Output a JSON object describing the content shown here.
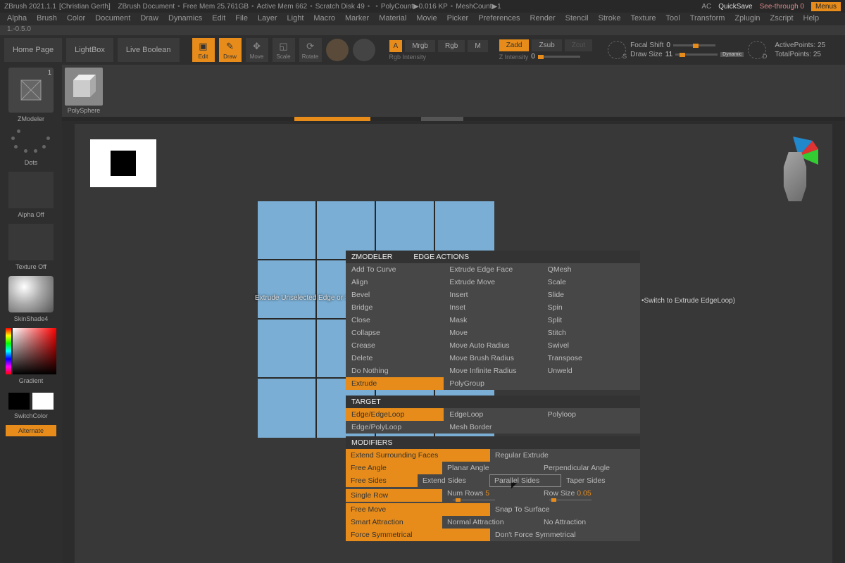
{
  "title": {
    "app": "ZBrush 2021.1.1",
    "user": "[Christian Gerth]",
    "doc": "ZBrush Document",
    "mem": "Free Mem 25.761GB",
    "active": "Active Mem 662",
    "scratch": "Scratch Disk 49",
    "poly": "PolyCount▶0.016 KP",
    "mesh": "MeshCount▶1",
    "ac": "AC",
    "quicksave": "QuickSave",
    "see": "See-through  0",
    "menus": "Menus"
  },
  "menu": [
    "Alpha",
    "Brush",
    "Color",
    "Document",
    "Draw",
    "Dynamics",
    "Edit",
    "File",
    "Layer",
    "Light",
    "Macro",
    "Marker",
    "Material",
    "Movie",
    "Picker",
    "Preferences",
    "Render",
    "Stencil",
    "Stroke",
    "Texture",
    "Tool",
    "Transform",
    "Zplugin",
    "Zscript",
    "Help"
  ],
  "subline": "1.-0.5.0",
  "tabs": {
    "home": "Home Page",
    "lightbox": "LightBox",
    "livebool": "Live Boolean"
  },
  "icons": {
    "edit": "Edit",
    "draw": "Draw",
    "move": "Move",
    "scale": "Scale",
    "rotate": "Rotate"
  },
  "rgb": {
    "a": "A",
    "mrgb": "Mrgb",
    "rgb": "Rgb",
    "m": "M",
    "intlabel": "Rgb Intensity"
  },
  "zmode": {
    "zadd": "Zadd",
    "zsub": "Zsub",
    "zcut": "Zcut",
    "zlabel": "Z Intensity",
    "zval": "0"
  },
  "focal": {
    "label": "Focal Shift",
    "val": "0"
  },
  "drawsize": {
    "label": "Draw Size",
    "val": "11",
    "dyn": "Dynamic"
  },
  "points": {
    "active": "ActivePoints: 25",
    "total": "TotalPoints: 25"
  },
  "left": {
    "brush": "ZModeler",
    "dots": "Dots",
    "alpha": "Alpha Off",
    "tex": "Texture Off",
    "mat": "SkinShade4",
    "gradient": "Gradient",
    "switch": "SwitchColor",
    "alt": "Alternate"
  },
  "polysphere": "PolySphere",
  "mesh_annot": "Extrude Unselected Edge or S",
  "hint_switch": "•Switch to Extrude EdgeLoop)",
  "zmodeler": {
    "header": {
      "z": "ZMODELER",
      "ea": "EDGE ACTIONS"
    },
    "col1": [
      "Add To Curve",
      "Align",
      "Bevel",
      "Bridge",
      "Close",
      "Collapse",
      "Crease",
      "Delete",
      "Do Nothing",
      "Extrude"
    ],
    "col2": [
      "Extrude Edge Face",
      "Extrude Move",
      "Insert",
      "Inset",
      "Mask",
      "Move",
      "Move Auto Radius",
      "Move Brush Radius",
      "Move Infinite Radius",
      "PolyGroup"
    ],
    "col3": [
      "QMesh",
      "Scale",
      "Slide",
      "Spin",
      "Split",
      "Stitch",
      "Swivel",
      "Transpose",
      "Unweld"
    ],
    "selected": "Extrude"
  },
  "target": {
    "header": "TARGET",
    "col1": [
      "Edge/EdgeLoop",
      "Edge/PolyLoop"
    ],
    "col2": [
      "EdgeLoop",
      "Mesh Border"
    ],
    "col3": [
      "Polyloop"
    ],
    "selected": "Edge/EdgeLoop"
  },
  "mods": {
    "header": "MODIFIERS",
    "r1": {
      "a": "Extend Surrounding Faces",
      "b": "Regular Extrude"
    },
    "r2": {
      "a": "Free Angle",
      "b": "Planar Angle",
      "c": "Perpendicular Angle"
    },
    "r3": {
      "a": "Free Sides",
      "b": "Extend Sides",
      "c": "Parallel Sides",
      "d": "Taper Sides"
    },
    "r4": {
      "a": "Single Row",
      "b": "Num Rows",
      "bval": "5",
      "c": "Row Size",
      "cval": "0.05"
    },
    "r5": {
      "a": "Free Move",
      "b": "Snap To Surface"
    },
    "r6": {
      "a": "Smart Attraction",
      "b": "Normal Attraction",
      "c": "No Attraction"
    },
    "r7": {
      "a": "Force Symmetrical",
      "b": "Don't Force Symmetrical"
    }
  }
}
